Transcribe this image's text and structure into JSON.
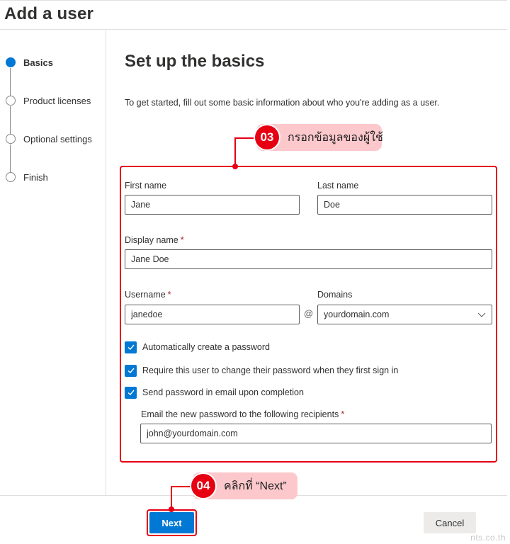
{
  "header": {
    "title": "Add a user"
  },
  "steps": [
    {
      "label": "Basics",
      "state": "active"
    },
    {
      "label": "Product licenses",
      "state": "pending"
    },
    {
      "label": "Optional settings",
      "state": "pending"
    },
    {
      "label": "Finish",
      "state": "pending"
    }
  ],
  "main": {
    "title": "Set up the basics",
    "description": "To get started, fill out some basic information about who you're adding as a user."
  },
  "form": {
    "first_name": {
      "label": "First name",
      "value": "Jane"
    },
    "last_name": {
      "label": "Last name",
      "value": "Doe"
    },
    "display_name": {
      "label": "Display name",
      "required_mark": "*",
      "value": "Jane Doe"
    },
    "username": {
      "label": "Username",
      "required_mark": "*",
      "value": "janedoe"
    },
    "at_symbol": "@",
    "domains": {
      "label": "Domains",
      "selected": "yourdomain.com"
    },
    "checkboxes": [
      {
        "label": "Automatically create a password",
        "checked": true
      },
      {
        "label": "Require this user to change their password when they first sign in",
        "checked": true
      },
      {
        "label": "Send password in email upon completion",
        "checked": true
      }
    ],
    "email_recipients": {
      "label": "Email the new password to the following recipients",
      "required_mark": "*",
      "value": "john@yourdomain.com"
    }
  },
  "footer": {
    "next_label": "Next",
    "cancel_label": "Cancel"
  },
  "annotations": [
    {
      "number": "03",
      "text": "กรอกข้อมูลของผู้ใช้"
    },
    {
      "number": "04",
      "text": "คลิกที่ “Next”"
    }
  ],
  "colors": {
    "accent": "#0078d4",
    "annotation_red": "#e60012",
    "annotation_pill": "#fcc8cc"
  },
  "watermark": "nts.co.th"
}
